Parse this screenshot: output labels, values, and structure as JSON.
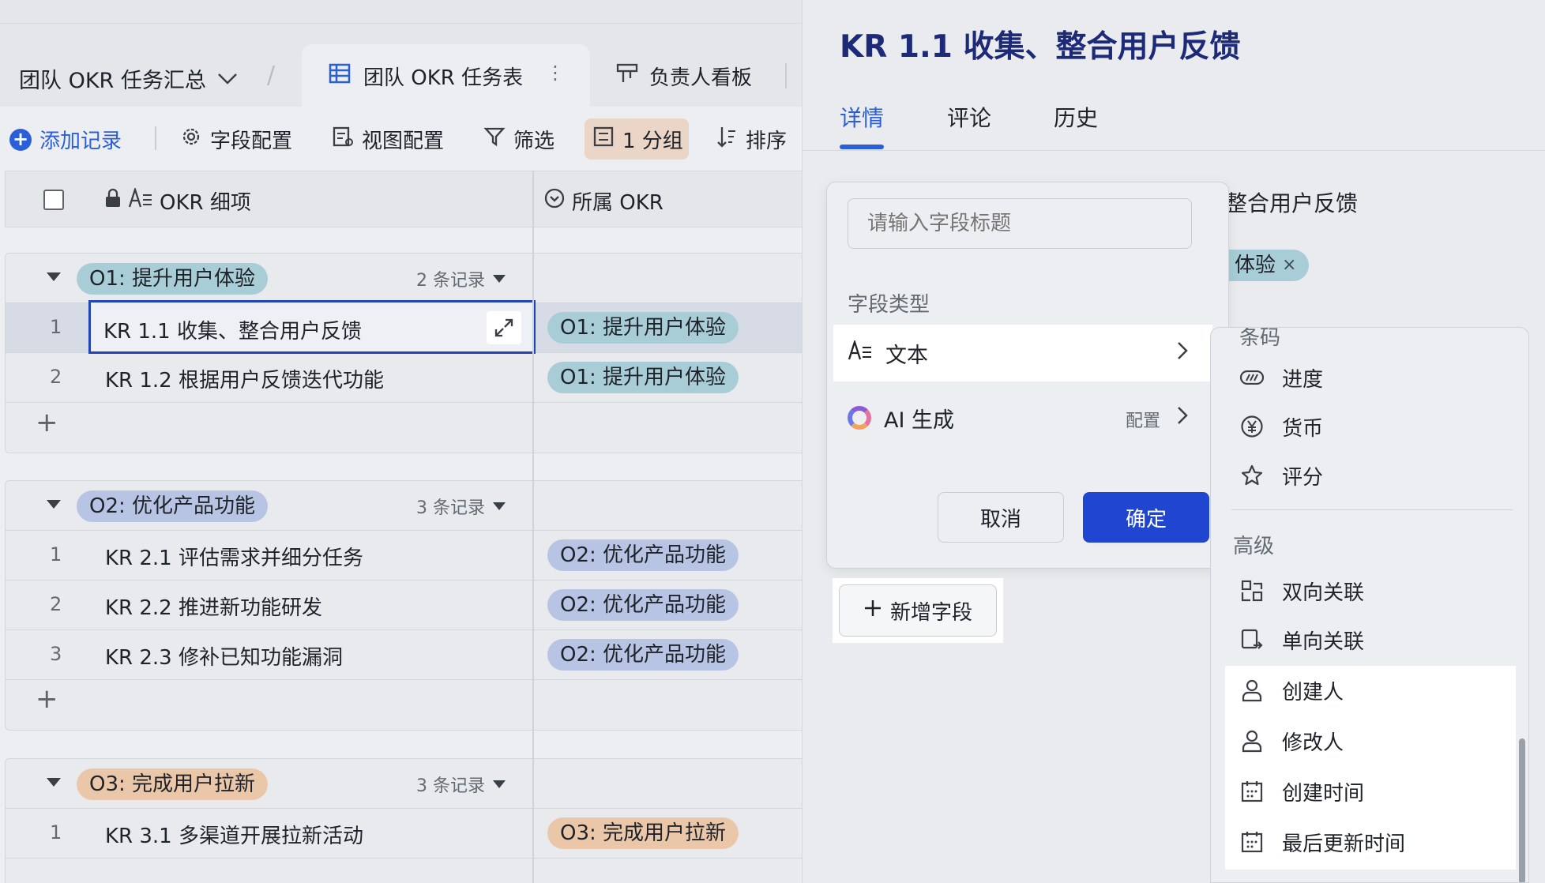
{
  "app": {
    "base_title": "团队 OKR 任务汇总",
    "tabs": [
      {
        "label": "团队 OKR 任务表",
        "active": true
      },
      {
        "label": "负责人看板",
        "active": false
      }
    ]
  },
  "toolbar": {
    "add_record": "添加记录",
    "field_config": "字段配置",
    "view_config": "视图配置",
    "filter": "筛选",
    "group": "1 分组",
    "sort": "排序"
  },
  "grid": {
    "columns": [
      "OKR 细项",
      "所属 OKR"
    ],
    "groups": [
      {
        "name": "O1: 提升用户体验",
        "count_label": "2 条记录",
        "rows": [
          {
            "num": "1",
            "title": "KR 1.1 收集、整合用户反馈",
            "okr": "O1: 提升用户体验"
          },
          {
            "num": "2",
            "title": "KR 1.2 根据用户反馈迭代功能",
            "okr": "O1: 提升用户体验"
          }
        ]
      },
      {
        "name": "O2: 优化产品功能",
        "count_label": "3 条记录",
        "rows": [
          {
            "num": "1",
            "title": "KR 2.1 评估需求并细分任务",
            "okr": "O2: 优化产品功能"
          },
          {
            "num": "2",
            "title": "KR 2.2 推进新功能研发",
            "okr": "O2: 优化产品功能"
          },
          {
            "num": "3",
            "title": "KR 2.3 修补已知功能漏洞",
            "okr": "O2: 优化产品功能"
          }
        ]
      },
      {
        "name": "O3: 完成用户拉新",
        "count_label": "3 条记录",
        "rows": [
          {
            "num": "1",
            "title": "KR 3.1 多渠道开展拉新活动",
            "okr": "O3: 完成用户拉新"
          }
        ]
      }
    ],
    "add_row_symbol": "+"
  },
  "panel": {
    "title": "KR 1.1 收集、整合用户反馈",
    "tabs": [
      "详情",
      "评论",
      "历史"
    ],
    "field_value_visible": "整合用户反馈",
    "tag_visible": "体验",
    "tag_close": "×"
  },
  "editor": {
    "title_placeholder": "请输入字段标题",
    "type_label": "字段类型",
    "type_selected": "文本",
    "ai_label": "AI 生成",
    "ai_config": "配置",
    "cancel": "取消",
    "confirm": "确定",
    "add_field": "新增字段"
  },
  "dropdown": {
    "cut_top": "条码",
    "basic_items": [
      "进度",
      "货币",
      "评分"
    ],
    "advanced_heading": "高级",
    "advanced_items": [
      "双向关联",
      "单向关联",
      "创建人",
      "修改人",
      "创建时间",
      "最后更新时间"
    ]
  },
  "colors": {
    "accent": "#2b5fd9",
    "confirm_button": "#1f45d1",
    "group1_tag": "#a8cdd6",
    "group2_tag": "#b8c4e3",
    "group3_tag": "#e9c7a8",
    "panel_title": "#1d2a78"
  }
}
